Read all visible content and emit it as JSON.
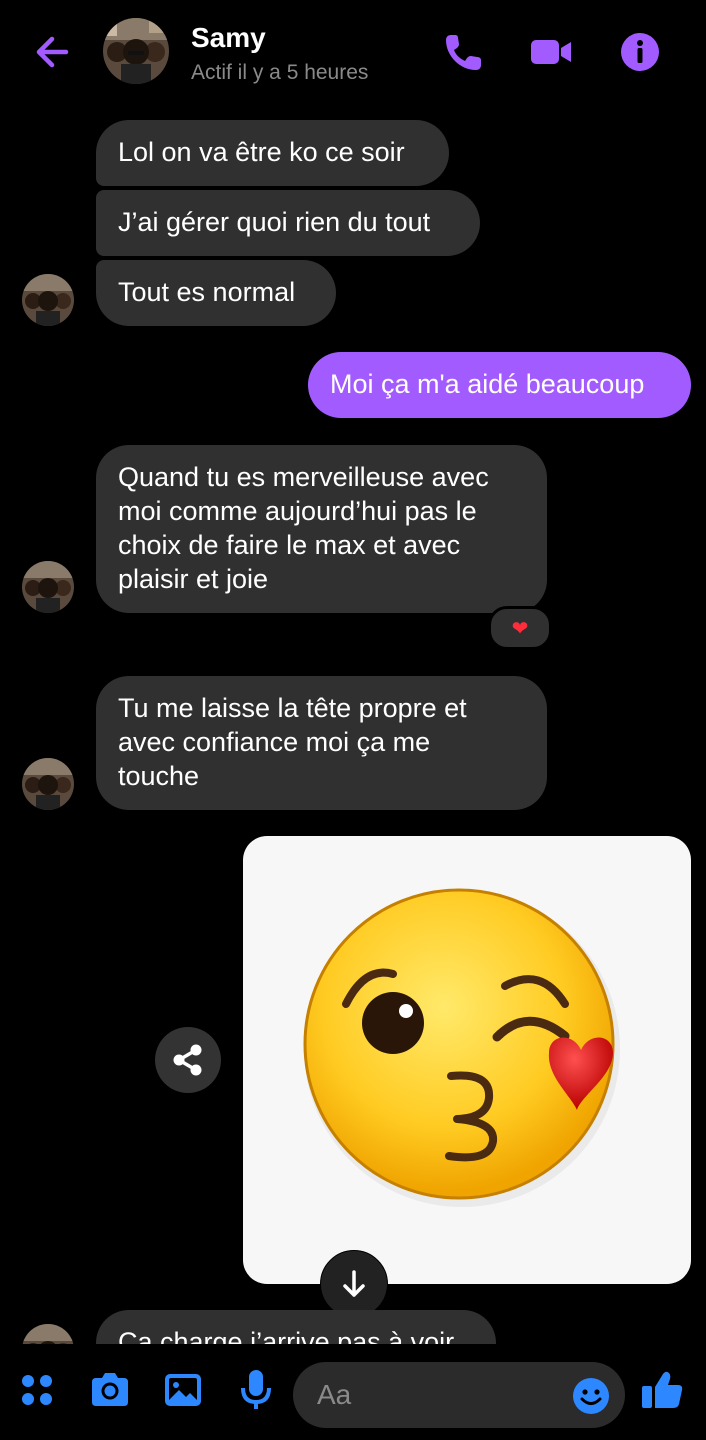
{
  "header": {
    "contact_name": "Samy",
    "status": "Actif il y a 5 heures",
    "icons": [
      "back-arrow-icon",
      "phone-icon",
      "video-camera-icon",
      "info-icon"
    ]
  },
  "colors": {
    "accent": "#a25bff",
    "bubble_incoming": "#303030",
    "background": "#000000",
    "composer_icon": "#2d88ff"
  },
  "messages": [
    {
      "from": "contact",
      "text": "Lol on va être ko ce soir"
    },
    {
      "from": "contact",
      "text": "J’ai gérer quoi rien du tout"
    },
    {
      "from": "contact",
      "text": "Tout es normal"
    },
    {
      "from": "me",
      "text": "Moi ça m'a aidé beaucoup"
    },
    {
      "from": "contact",
      "text": "Quand tu es merveilleuse avec\nmoi comme aujourd’hui pas le\nchoix de faire le max et avec\nplaisir et joie",
      "reaction": "❤"
    },
    {
      "from": "contact",
      "text": "Tu me laisse la tête propre et\navec confiance moi ça me\ntouche"
    },
    {
      "from": "me",
      "type": "sticker",
      "sticker": "kissing-face-wink-heart-sticker"
    },
    {
      "from": "contact",
      "text": "Ça charge j’arrive pas à voir"
    }
  ],
  "composer": {
    "placeholder": "Aa",
    "icons": [
      "menu-grid-icon",
      "camera-icon",
      "gallery-icon",
      "microphone-icon",
      "emoji-icon",
      "thumbs-up-icon"
    ]
  }
}
